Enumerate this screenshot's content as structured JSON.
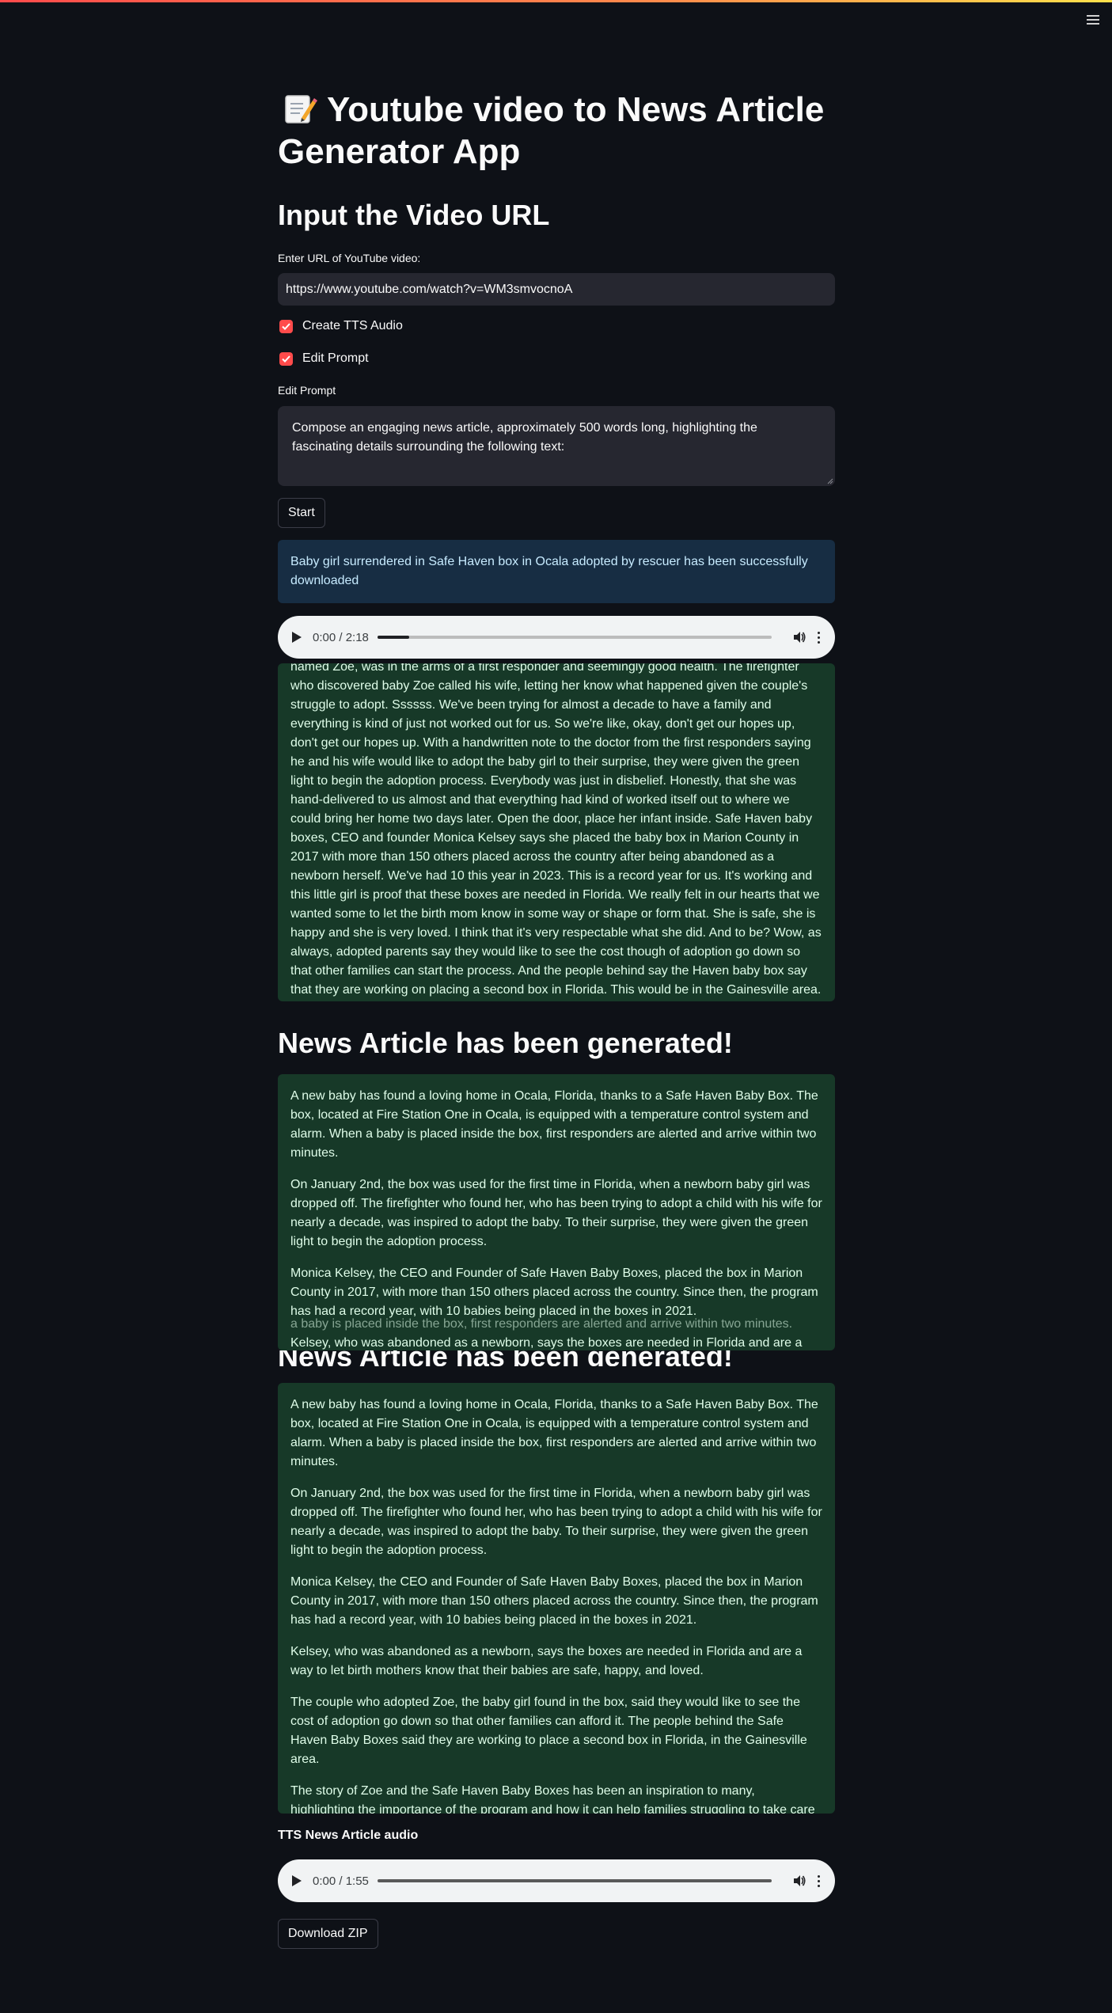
{
  "app": {
    "title": "Youtube video to News Article Generator App",
    "title_emoji": "memo-icon"
  },
  "input_section": {
    "heading": "Input the Video URL",
    "url_label": "Enter URL of YouTube video:",
    "url_value": "https://www.youtube.com/watch?v=WM3smvocnoA",
    "create_tts_label": "Create TTS Audio",
    "create_tts_checked": true,
    "edit_prompt_label": "Edit Prompt",
    "edit_prompt_checked": true,
    "prompt_label": "Edit Prompt",
    "prompt_value": "Compose an engaging news article, approximately 500 words long, highlighting the fascinating details surrounding the following text:",
    "start_button": "Start"
  },
  "download_info": "Baby girl surrendered in Safe Haven box in Ocala adopted by rescuer has been successfully downloaded",
  "video_audio": {
    "time": "0:00 / 2:18",
    "progress": 0.08
  },
  "transcript": "named Zoe, was in the arms of a first responder and seemingly good health. The firefighter who discovered baby Zoe called his wife, letting her know what happened given the couple's struggle to adopt. Ssssss. We've been trying for almost a decade to have a family and everything is kind of just not worked out for us. So we're like, okay, don't get our hopes up, don't get our hopes up. With a handwritten note to the doctor from the first responders saying he and his wife would like to adopt the baby girl to their surprise, they were given the green light to begin the adoption process. Everybody was just in disbelief. Honestly, that she was hand-delivered to us almost and that everything had kind of worked itself out to where we could bring her home two days later. Open the door, place her infant inside. Safe Haven baby boxes, CEO and founder Monica Kelsey says she placed the baby box in Marion County in 2017 with more than 150 others placed across the country after being abandoned as a newborn herself. We've had 10 this year in 2023. This is a record year for us. It's working and this little girl is proof that these boxes are needed in Florida. We really felt in our hearts that we wanted some to let the birth mom know in some way or shape or form that. She is safe, she is happy and she is very loved. I think that it's very respectable what she did. And to be? Wow, as always, adopted parents say they would like to see the cost though of adoption go down so that other families can start the process. And the people behind say the Haven baby box say that they are working on placing a second box in Florida. This would be in the Gainesville area.",
  "article_section": {
    "heading": "News Article has been generated!",
    "paragraphs": [
      "A new baby has found a loving home in Ocala, Florida, thanks to a Safe Haven Baby Box. The box, located at Fire Station One in Ocala, is equipped with a temperature control system and alarm. When a baby is placed inside the box, first responders are alerted and arrive within two minutes.",
      "On January 2nd, the box was used for the first time in Florida, when a newborn baby girl was dropped off. The firefighter who found her, who has been trying to adopt a child with his wife for nearly a decade, was inspired to adopt the baby. To their surprise, they were given the green light to begin the adoption process.",
      "Monica Kelsey, the CEO and Founder of Safe Haven Baby Boxes, placed the box in Marion County in 2017, with more than 150 others placed across the country. Since then, the program has had a record year, with 10 babies being placed in the boxes in 2021.",
      "Kelsey, who was abandoned as a newborn, says the boxes are needed in Florida and are a way to let birth mothers know that their babies are safe, happy, and loved.",
      "The couple who adopted Zoe, the baby girl found in the box, said they would like to see the cost of adoption go down so that other families can afford it. The people behind the Safe Haven Baby Boxes said they are working to place a second box in Florida, in the Gainesville area.",
      "The story of Zoe and the Safe Haven Baby Boxes has been an inspiration to many, highlighting the importance of the program and how it can help families struggling to take care of newborns. As the couple who adopted Zoe said, “It’s very respectable what she did.”"
    ],
    "ghost_line": "a baby is placed inside the box, first responders are alerted and arrive within two minutes."
  },
  "tts_section": {
    "label": "TTS News Article audio",
    "time": "0:00 / 1:55",
    "progress": 0.0
  },
  "download_zip": "Download ZIP",
  "colors": {
    "background": "#0e1117",
    "accent": "#ff4b4b",
    "info_bg": "#172d43",
    "success_bg": "#173928"
  }
}
